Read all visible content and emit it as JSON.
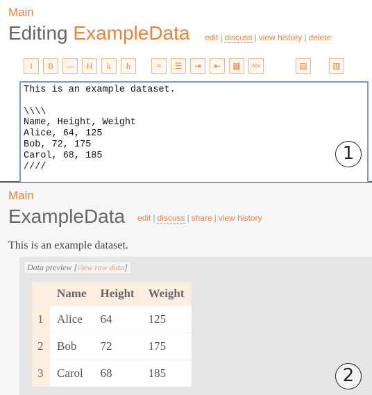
{
  "panel1": {
    "breadcrumb": "Main",
    "title_prefix": "Editing",
    "title_name": "ExampleData",
    "actions": [
      "edit",
      "discuss",
      "view history",
      "delete"
    ],
    "toolbar": [
      {
        "icon": "italic-icon",
        "glyph": "I"
      },
      {
        "icon": "bold-icon",
        "glyph": "B"
      },
      {
        "icon": "horizontal-rule-icon",
        "glyph": "—"
      },
      {
        "icon": "heading-icon",
        "glyph": "H"
      },
      {
        "icon": "link-icon",
        "glyph": "k"
      },
      {
        "icon": "image-icon",
        "glyph": "h"
      },
      {
        "icon": "bulleted-list-icon",
        "glyph": "≡"
      },
      {
        "icon": "numbered-list-icon",
        "glyph": "☰"
      },
      {
        "icon": "indent-icon",
        "glyph": "⇥"
      },
      {
        "icon": "outdent-icon",
        "glyph": "⇤"
      },
      {
        "icon": "table-icon",
        "glyph": "▦"
      },
      {
        "icon": "text-icon",
        "glyph": "Abc"
      },
      {
        "icon": "data-icon",
        "glyph": "▤"
      },
      {
        "icon": "chart-icon",
        "glyph": "▥"
      }
    ],
    "editor_text": "This is an example dataset.\n\n\\\\\\\\\nName, Height, Weight\nAlice, 64, 125\nBob, 72, 175\nCarol, 68, 185\n////",
    "marker": "1"
  },
  "panel2": {
    "breadcrumb": "Main",
    "title_name": "ExampleData",
    "actions": [
      "edit",
      "discuss",
      "share",
      "view history"
    ],
    "description": "This is an example dataset.",
    "preview_label": "Data preview",
    "preview_link": "view raw data",
    "columns": [
      "Name",
      "Height",
      "Weight"
    ],
    "rows": [
      {
        "num": "1",
        "name": "Alice",
        "height": "64",
        "weight": "125"
      },
      {
        "num": "2",
        "name": "Bob",
        "height": "72",
        "weight": "175"
      },
      {
        "num": "3",
        "name": "Carol",
        "height": "68",
        "weight": "185"
      }
    ],
    "marker": "2"
  }
}
